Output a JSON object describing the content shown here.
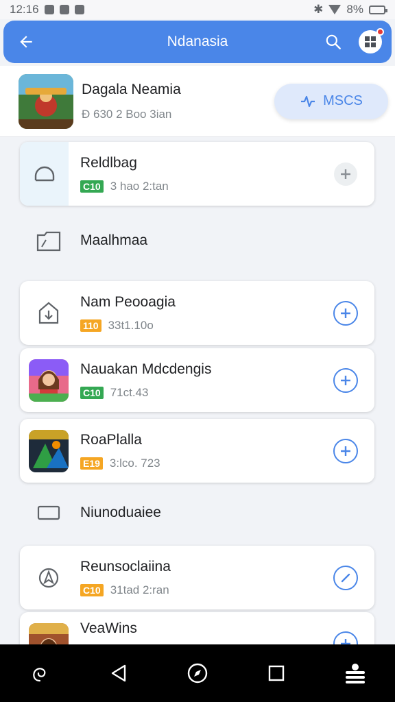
{
  "status": {
    "time": "12:16",
    "battery": "8%"
  },
  "app_bar": {
    "title": "Ndanasia"
  },
  "header": {
    "title": "Dagala Neamia",
    "subtitle": "Ð 630 2 Boo 3ian",
    "button_label": "MSCS"
  },
  "items": [
    {
      "title": "Reldlbag",
      "badge": "C10",
      "meta": "3 hao 2:tan"
    },
    {
      "label": "Maalhmaa"
    },
    {
      "title": "Nam Peooagia",
      "badge": "110",
      "meta": "33t1.10o"
    },
    {
      "title": "Nauakan Mdcdengis",
      "badge": "C10",
      "meta": "71ct.43"
    },
    {
      "title": "RoaPlalla",
      "badge": "E19",
      "meta": "3:lco. 723"
    },
    {
      "label": "Niunoduaiee"
    },
    {
      "title": "Reunsoclaiina",
      "badge": "C10",
      "meta": "31tad 2:ran"
    },
    {
      "title": "VeaWins"
    }
  ],
  "colors": {
    "accent": "#4a86e8",
    "badge_green": "#34a853",
    "badge_orange": "#f5a623"
  }
}
